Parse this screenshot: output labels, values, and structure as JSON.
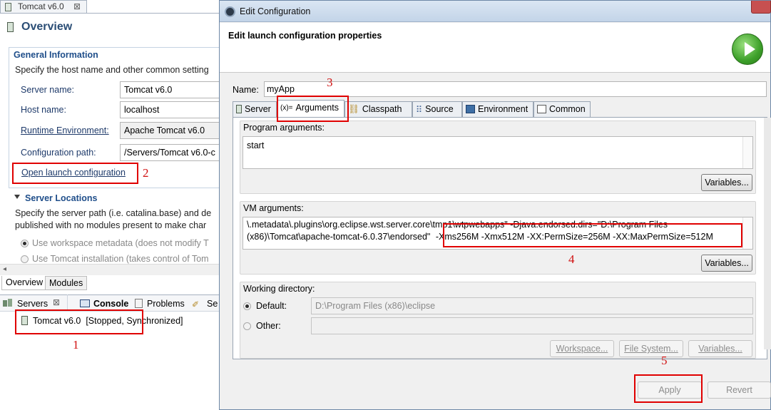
{
  "editor": {
    "tab_label": "Tomcat v6.0",
    "tab_close": "⊠",
    "overview_title": "Overview",
    "general": {
      "header": "General Information",
      "description": "Specify the host name and other common setting",
      "fields": [
        {
          "label": "Server name:",
          "value": "Tomcat v6.0"
        },
        {
          "label": "Host name:",
          "value": "localhost"
        },
        {
          "label": "Runtime Environment:",
          "value": "Apache Tomcat v6.0"
        },
        {
          "label": "Configuration path:",
          "value": "/Servers/Tomcat v6.0-c"
        }
      ],
      "open_launch_link": "Open launch configuration"
    },
    "locations": {
      "header": "Server Locations",
      "description_1": "Specify the server path (i.e. catalina.base) and de",
      "description_2": "published with no modules present to make char",
      "option_1": "Use workspace metadata (does not modify T",
      "option_2": "Use Tomcat installation (takes control of Tom"
    },
    "bottom_tabs": [
      "Overview",
      "Modules"
    ]
  },
  "views": {
    "tabs": [
      "Servers",
      "Console",
      "Problems",
      "Se"
    ],
    "server_entry": "Tomcat v6.0  [Stopped, Synchronized]"
  },
  "dialog": {
    "title": "Edit Configuration",
    "header": "Edit launch configuration properties",
    "name_label": "Name:",
    "name_value": "myApp",
    "tabs": [
      "Server",
      "Arguments",
      "Classpath",
      "Source",
      "Environment",
      "Common"
    ],
    "program_args_label": "Program arguments:",
    "program_args_value": "start",
    "variables_label": "Variables...",
    "vm_args_label": "VM arguments:",
    "vm_args_line1": "\\.metadata\\.plugins\\org.eclipse.wst.server.core\\tmp1\\wtpwebapps\" -Djava.endorsed.dirs=\"D:\\Program Files",
    "vm_args_line2": "(x86)\\Tomcat\\apache-tomcat-6.0.37\\endorsed\"",
    "vm_args_memory": "-Xms256M -Xmx512M -XX:PermSize=256M -XX:MaxPermSize=512M",
    "working_dir_label": "Working directory:",
    "default_label": "Default:",
    "default_value": "D:\\Program Files (x86)\\eclipse",
    "other_label": "Other:",
    "workspace_btn": "Workspace...",
    "filesystem_btn": "File System...",
    "variables_btn": "Variables...",
    "apply_btn": "Apply",
    "revert_btn": "Revert"
  },
  "annotations": [
    "1",
    "2",
    "3",
    "4",
    "5"
  ],
  "colors": {
    "annotation_red": "#e00000",
    "section_header": "#1f4e8a"
  }
}
